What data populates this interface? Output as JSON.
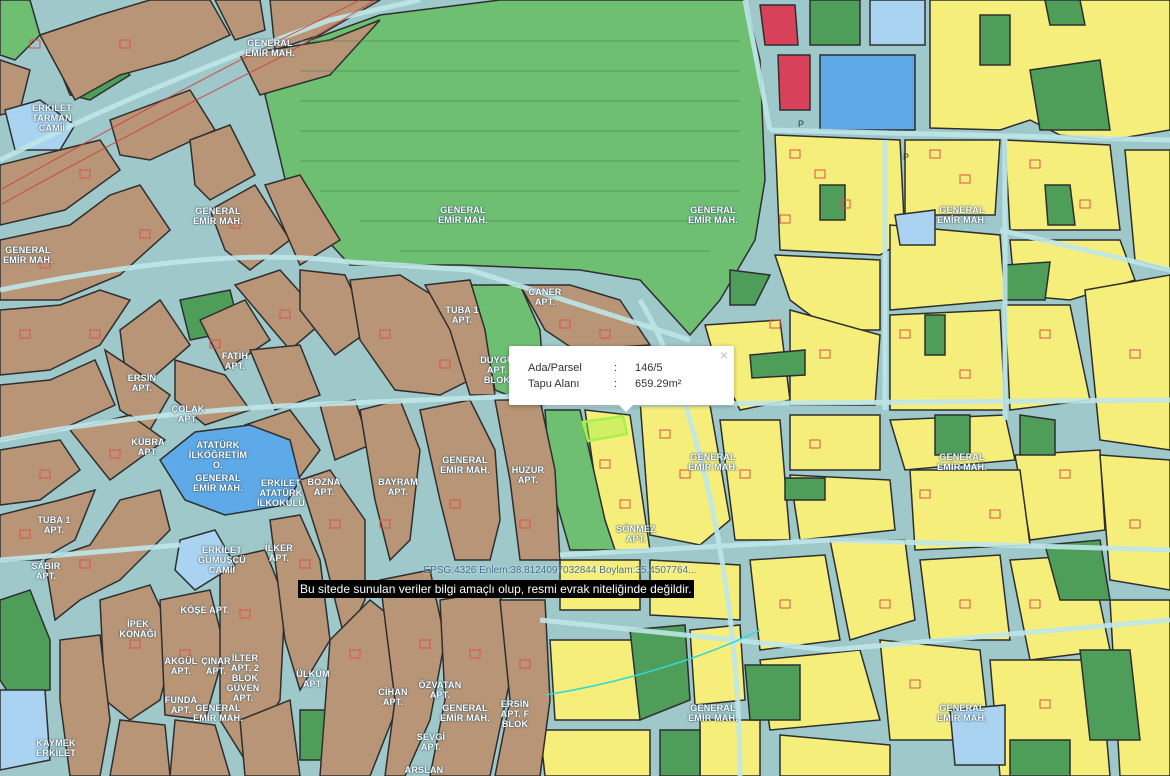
{
  "map": {
    "colors": {
      "road": "#9ec8c9",
      "residential_yellow": "#f5ee7a",
      "residential_brown": "#b89576",
      "park_green": "#6fbf73",
      "park_dark": "#4e9e5a",
      "education_blue": "#5ea9e8",
      "mosque_lightblue": "#a9d3f0",
      "commercial_red": "#d8415a",
      "selected_parcel": "#a7f04a"
    },
    "labels": {
      "general_emir_1": "GENERAL EMİR MAH.",
      "general_emir_2": "GENERAL EMİR MAH.",
      "general_emir_3": "GENERAL EMİR MAH.",
      "general_emir_4": "GENERAL EMİR MAH.",
      "general_emir_5": "GENERAL EMİR MAH.",
      "general_emir_6": "GENERAL EMİR MAH.",
      "general_emir_7": "GENERAL EMİR MAH.",
      "general_emir_8": "GENERAL EMİR MAH.",
      "general_emir_9": "GENERAL EMİR MAH.",
      "general_emir_10": "GENERAL EMİR MAH.",
      "general_emir_11": "GENERAL EMİR MAH.",
      "general_emir_12": "GENERAL EMİR MAH.",
      "general_emir_13": "GENERAL EMİR MAH.",
      "erkilet_tarman": "ERKİLET TARMAN CAMİİ",
      "tuba_apt": "TUBA 1 APT.",
      "tuba_apt2": "TUBA 1 APT.",
      "caner_apt": "CANER APT.",
      "duygu_apt": "DUYGU APT. BLOK",
      "fatih_apt": "FATİH APT.",
      "ersin_apt": "ERSİN APT.",
      "colak_apt": "ÇOLAK APT.",
      "kubra_apt": "KÜBRA APT.",
      "ataturk_ilkogretim": "ATATÜRK İLKÖĞRETİM O.",
      "erkilet_ataturk": "ERKİLET ATATÜRK İLKOKULU",
      "bozna_apt": "BOZNA APT.",
      "bayram_apt": "BAYRAM APT.",
      "huzur_apt": "HUZUR APT.",
      "sonmez_apt": "SÖNMEZ APT.",
      "sabir_apt": "SABIR APT.",
      "erkilet_gumuscu": "ERKİLET GÜMÜŞCÜ CAMİİ",
      "ilker_apt": "İLKER APT.",
      "kose_apt": "KÖŞE APT.",
      "ipek_konagi": "İPEK KONAĞI",
      "akgul_apt": "AKGÜL APT.",
      "cinar_apt": "ÇINAR APT.",
      "ilter_apt": "İLTER APT. 2 BLOK",
      "guven_apt": "GÜVEN APT.",
      "funda_apt": "FUNDA APT.",
      "ulkum_apt": "ÜLKÜM APT.",
      "cihan_apt": "CİHAN APT.",
      "ozvatan_apt": "ÖZVATAN APT.",
      "ersin_f_apt": "ERSİN APT. F BLOK",
      "sevgi_apt": "SEVGİ APT.",
      "arslan": "ARSLAN",
      "kaymek": "KAYMEK ERKİLET"
    }
  },
  "popup": {
    "row1_key": "Ada/Parsel",
    "row1_sep": ":",
    "row1_value": "146/5",
    "row2_key": "Tapu Alanı",
    "row2_sep": ":",
    "row2_value": "659.29m²",
    "close_symbol": "×"
  },
  "coordinates": "EPSG:4326 Enlem:38.8124097032844 Boylam:35.4507764...",
  "disclaimer": "Bu sitede sunulan veriler bilgi amaçlı olup, resmi evrak niteliğinde değildir."
}
